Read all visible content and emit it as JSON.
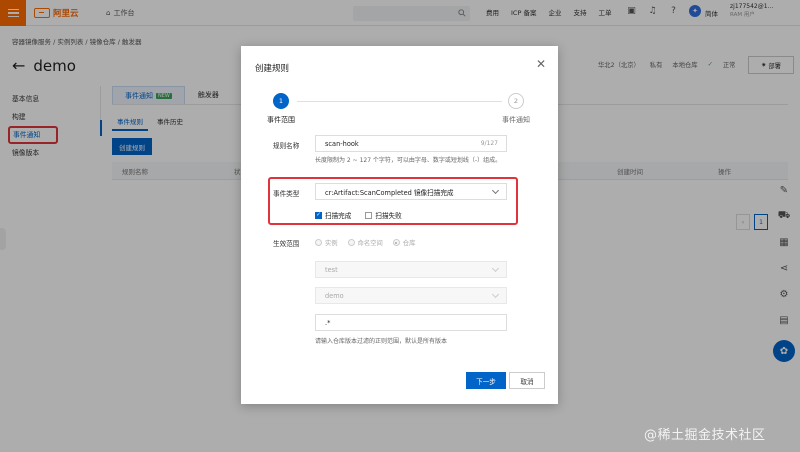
{
  "topbar": {
    "brand": "阿里云",
    "workbench": "工作台",
    "links": [
      "费用",
      "ICP 备案",
      "企业",
      "支持",
      "工单"
    ],
    "lang": "简体",
    "user_name": "zj177542@1...",
    "user_sub": "RAM 用户"
  },
  "breadcrumb": "容器镜像服务 / 实例列表 / 镜像仓库 / 触发器",
  "page": {
    "title": "demo",
    "meta": [
      "华北2（北京）",
      "私有",
      "本地仓库"
    ],
    "meta_status": "正常",
    "deploy": "部署"
  },
  "sidebar": {
    "items": [
      {
        "label": "基本信息"
      },
      {
        "label": "构建"
      },
      {
        "label": "事件通知"
      },
      {
        "label": "镜像版本"
      }
    ]
  },
  "main": {
    "tabs": [
      {
        "label": "事件通知",
        "badge": "NEW"
      },
      {
        "label": "触发器"
      }
    ],
    "subtabs": [
      "事件规则",
      "事件历史"
    ],
    "create_button": "创建规则",
    "columns": [
      "规则名称",
      "状",
      "创建时间",
      "操作"
    ],
    "page_number": "1"
  },
  "modal": {
    "title": "创建规则",
    "steps": [
      {
        "num": "1",
        "label": "事件范围"
      },
      {
        "num": "2",
        "label": "事件通知"
      }
    ],
    "rule_name_label": "规则名称",
    "rule_name_value": "scan-hook",
    "rule_name_count": "9/127",
    "rule_name_hint": "长度限制为 2 ~ 127 个字符，可以由字母、数字或短划线（-）组成。",
    "event_type_label": "事件类型",
    "event_type_value": "cr:Artifact:ScanCompleted 镜像扫描完成",
    "checkbox_scan_done": "扫描完成",
    "checkbox_scan_fail": "扫描失败",
    "scope_label": "生效范围",
    "scope_options": [
      "实例",
      "命名空间",
      "仓库"
    ],
    "namespace_value": "test",
    "repo_value": "demo",
    "tag_regex_value": ".*",
    "tag_hint": "请输入仓库版本过滤的正则范围，默认是所有版本",
    "next_button": "下一步",
    "cancel_button": "取消"
  },
  "watermark": "@稀土掘金技术社区"
}
